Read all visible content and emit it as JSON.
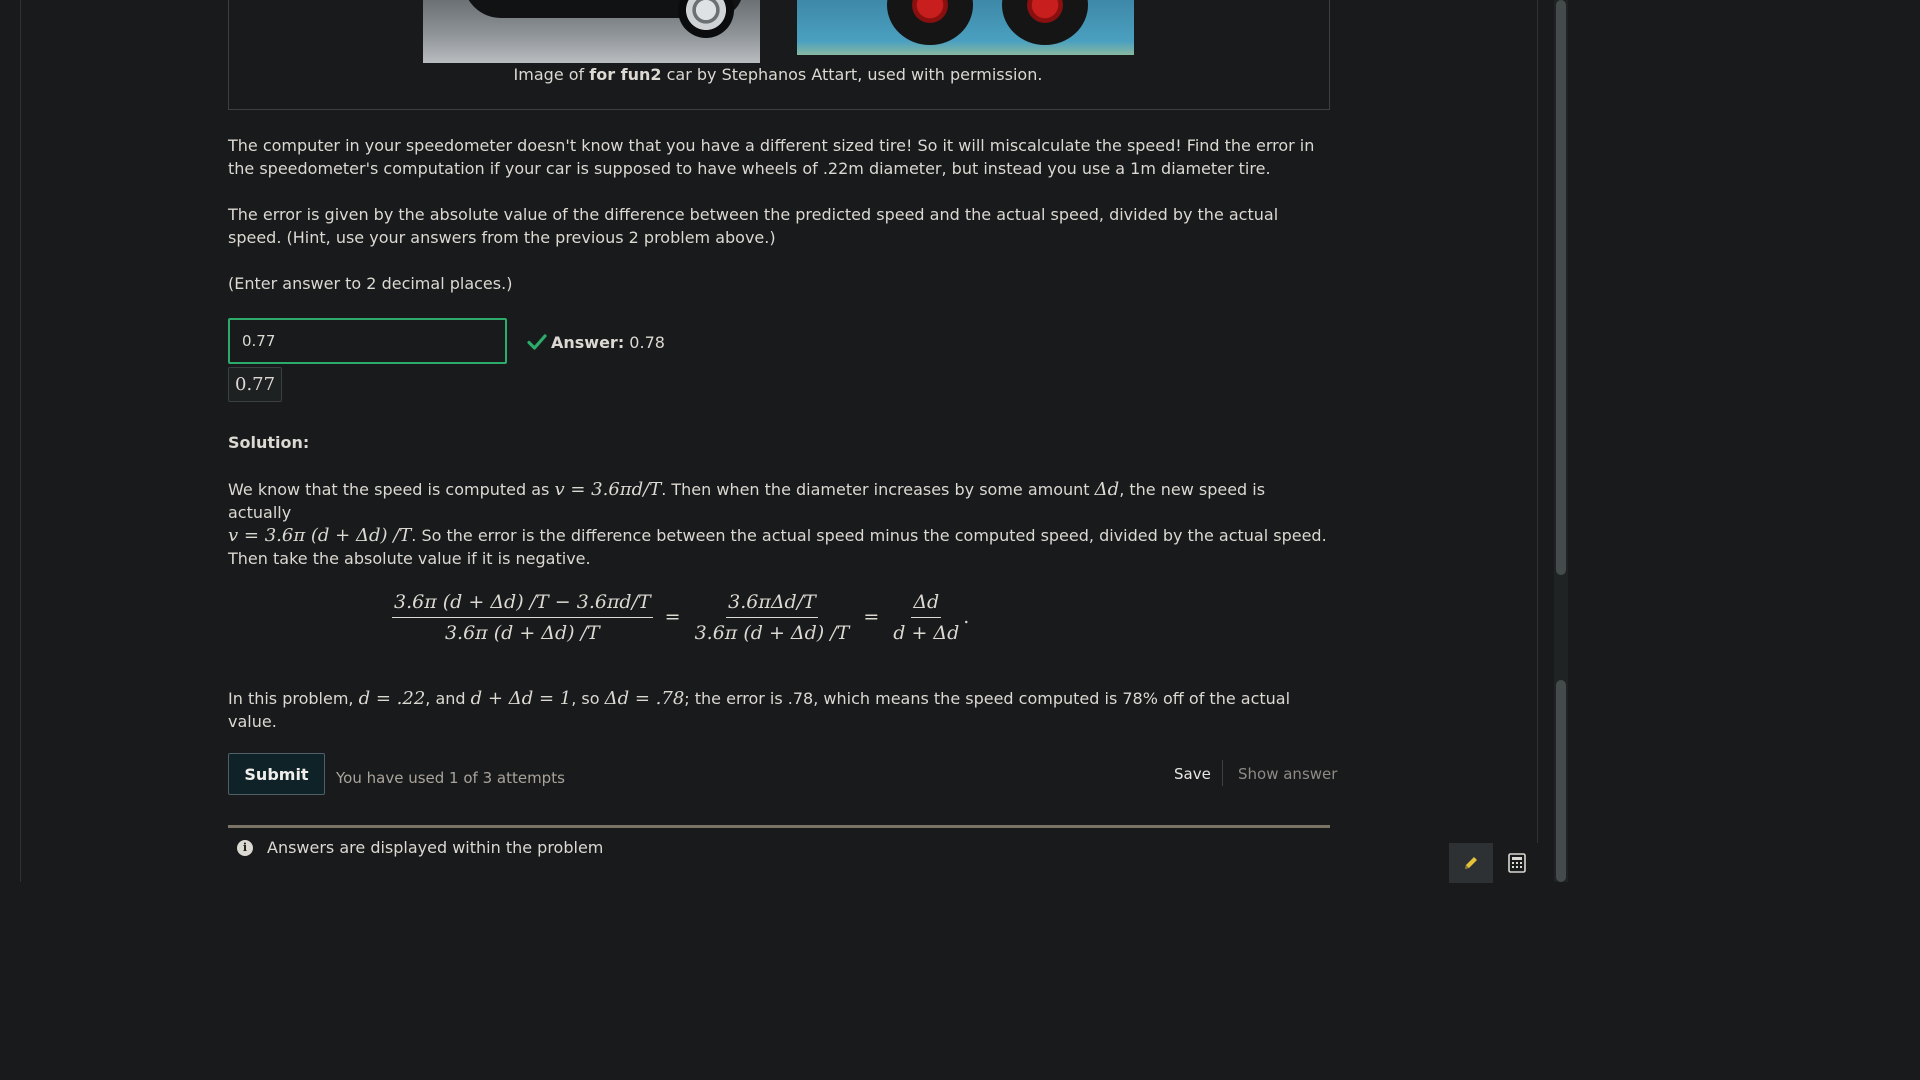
{
  "figure": {
    "caption_prefix": "Image of ",
    "caption_bold": "for fun2",
    "caption_suffix": " car by Stephanos Attart, used with permission."
  },
  "problem": {
    "para1": "The computer in your speedometer doesn't know that you have a different sized tire! So it will miscalculate the speed! Find the error in the speedometer's computation if your car is supposed to have wheels of .22m diameter, but instead you use a 1m diameter tire.",
    "para2": "The error is given by the absolute value of the difference between the predicted speed and the actual speed, divided by the actual speed. (Hint, use your answers from the previous 2 problem above.)",
    "para3": "(Enter answer to 2 decimal places.)"
  },
  "response": {
    "input_value": "0.77",
    "answer_label": "Answer:",
    "answer_value": " 0.78",
    "preview_value": "0.77"
  },
  "solution": {
    "heading": "Solution:",
    "s1": "We know that the speed is computed as ",
    "m1": "v = 3.6πd/T",
    "s2": ". Then when the diameter increases by some amount ",
    "m2": "Δd",
    "s3": ", the new speed is actually",
    "m3": "v = 3.6π (d + Δd) /T",
    "s4": ". So the error is the difference between the actual speed minus the computed speed, divided by the actual speed.",
    "s5": "Then take the absolute value if it is negative.",
    "frac1_num": "3.6π (d + Δd) /T − 3.6πd/T",
    "frac1_den": "3.6π (d + Δd) /T",
    "frac2_num": "3.6πΔd/T",
    "frac2_den": "3.6π (d + Δd) /T",
    "frac3_num": "Δd",
    "frac3_den": "d + Δd",
    "eq_sign": "=",
    "period": ".",
    "c1": "In this problem, ",
    "cm1": "d = .22",
    "c2": ", and ",
    "cm2": "d + Δd = 1",
    "c3": ", so ",
    "cm3": "Δd = .78",
    "c4": "; the error is .78, which means the speed computed is 78% off of the actual value."
  },
  "actions": {
    "submit_label": "Submit",
    "attempts_text": "You have used 1 of 3 attempts",
    "save_label": "Save",
    "show_answer_label": "Show answer"
  },
  "notice": {
    "text": "Answers are displayed within the problem",
    "icon": "info-icon"
  },
  "colors": {
    "background": "#181a1b",
    "text": "#dcd8d2",
    "correct_green": "#2cab6a",
    "submit_bg": "#0e2228",
    "pencil_yellow": "#e6c23a"
  }
}
